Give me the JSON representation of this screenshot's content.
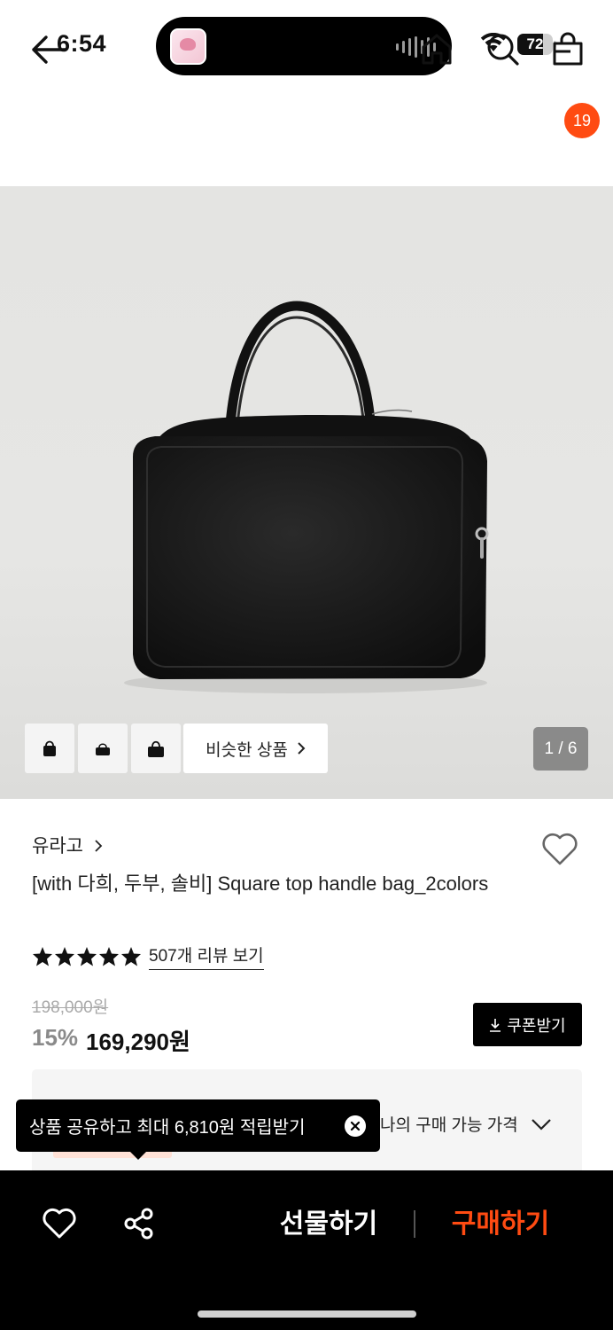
{
  "status_bar": {
    "time": "6:54",
    "battery_percent": 72,
    "battery_label": "72"
  },
  "nav": {
    "icons": [
      "back-arrow-icon",
      "home-icon",
      "search-icon",
      "shopping-bag-icon"
    ],
    "cart_badge": "19"
  },
  "gallery": {
    "similar_products_label": "비슷한 상품",
    "page_counter": "1 / 6",
    "thumbnail_count": 3
  },
  "product": {
    "brand": "유라고",
    "title": "[with 다희, 두부, 솔비] Square top handle bag_2colors",
    "rating_stars": 5,
    "review_link": "507개 리뷰 보기",
    "original_price": "198,000원",
    "discount": "15%",
    "sale_price": "169,290원",
    "coupon_label": "쿠폰받기",
    "my_price_label": "나의 구매 가능 가격"
  },
  "tooltip": {
    "text": "상품 공유하고 최대 6,810원 적립받기"
  },
  "bottom_bar": {
    "gift_label": "선물하기",
    "buy_label": "구매하기"
  },
  "colors": {
    "accent": "#ff4b12",
    "background": "#ffffff",
    "bottom_bar": "#000000",
    "image_bg": "#e4e4e2"
  }
}
